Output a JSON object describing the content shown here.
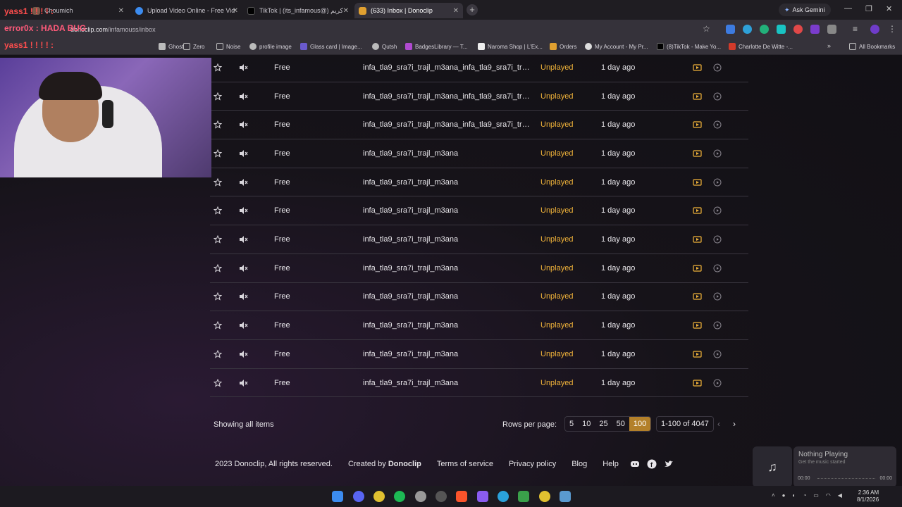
{
  "browser": {
    "tabs": [
      {
        "title": "Choumich",
        "active": false
      },
      {
        "title": "Upload Video Online - Free Vid",
        "active": false
      },
      {
        "title": "TikTok | (its_infamous@) كريم",
        "active": false
      },
      {
        "title": "(633) Inbox | Donoclip",
        "active": true
      }
    ],
    "gemini_label": "Ask Gemini",
    "url_host": "donoclip.com",
    "url_path": "/infamouss/inbox",
    "bookmarks": [
      "Ghost",
      "Zero",
      "Noise",
      "profile image",
      "Glass card | Image...",
      "Qutsh",
      "BadgesLibrary — T...",
      "Naroma Shop | L'Ex...",
      "Orders",
      "My Account - My Pr...",
      "(8)TikTok - Make Yo...",
      "Charlotte De Witte -...",
      "All Bookmarks"
    ]
  },
  "overlay": {
    "line1": "yass1 ! ! ! ! :",
    "line2": "error0x : HADA BUG",
    "line3": "yass1 ! ! ! ! :"
  },
  "inbox": {
    "rows": [
      {
        "price": "Free",
        "message": "infa_tla9_sra7i_trajl_m3ana_infa_tla9_sra7i_trajl...",
        "status": "Unplayed",
        "time": "1 day ago"
      },
      {
        "price": "Free",
        "message": "infa_tla9_sra7i_trajl_m3ana_infa_tla9_sra7i_trajl...",
        "status": "Unplayed",
        "time": "1 day ago"
      },
      {
        "price": "Free",
        "message": "infa_tla9_sra7i_trajl_m3ana_infa_tla9_sra7i_trajl...",
        "status": "Unplayed",
        "time": "1 day ago"
      },
      {
        "price": "Free",
        "message": "infa_tla9_sra7i_trajl_m3ana",
        "status": "Unplayed",
        "time": "1 day ago"
      },
      {
        "price": "Free",
        "message": "infa_tla9_sra7i_trajl_m3ana",
        "status": "Unplayed",
        "time": "1 day ago"
      },
      {
        "price": "Free",
        "message": "infa_tla9_sra7i_trajl_m3ana",
        "status": "Unplayed",
        "time": "1 day ago"
      },
      {
        "price": "Free",
        "message": "infa_tla9_sra7i_trajl_m3ana",
        "status": "Unplayed",
        "time": "1 day ago"
      },
      {
        "price": "Free",
        "message": "infa_tla9_sra7i_trajl_m3ana",
        "status": "Unplayed",
        "time": "1 day ago"
      },
      {
        "price": "Free",
        "message": "infa_tla9_sra7i_trajl_m3ana",
        "status": "Unplayed",
        "time": "1 day ago"
      },
      {
        "price": "Free",
        "message": "infa_tla9_sra7i_trajl_m3ana",
        "status": "Unplayed",
        "time": "1 day ago"
      },
      {
        "price": "Free",
        "message": "infa_tla9_sra7i_trajl_m3ana",
        "status": "Unplayed",
        "time": "1 day ago"
      },
      {
        "price": "Free",
        "message": "infa_tla9_sra7i_trajl_m3ana",
        "status": "Unplayed",
        "time": "1 day ago"
      }
    ],
    "showing_label": "Showing all items",
    "rows_per_page_label": "Rows per page:",
    "rows_per_page_options": [
      "5",
      "10",
      "25",
      "50",
      "100"
    ],
    "rows_per_page_selected": "100",
    "range_label": "1-100 of 4047"
  },
  "footer": {
    "copyright": "2023 Donoclip, All rights reserved.",
    "created_by_prefix": "Created by",
    "created_by_brand": "Donoclip",
    "links": [
      "Terms of service",
      "Privacy policy",
      "Blog",
      "Help"
    ]
  },
  "music_widget": {
    "title": "Nothing Playing",
    "subtitle": "Get the music started",
    "elapsed": "00:00",
    "duration": "00:00"
  },
  "system": {
    "time": "2:36 AM",
    "date": "8/1/2026"
  },
  "colors": {
    "status_unplayed": "#f2b43a",
    "rows_selected": "#b3802a",
    "accent_bg": "#141217"
  }
}
